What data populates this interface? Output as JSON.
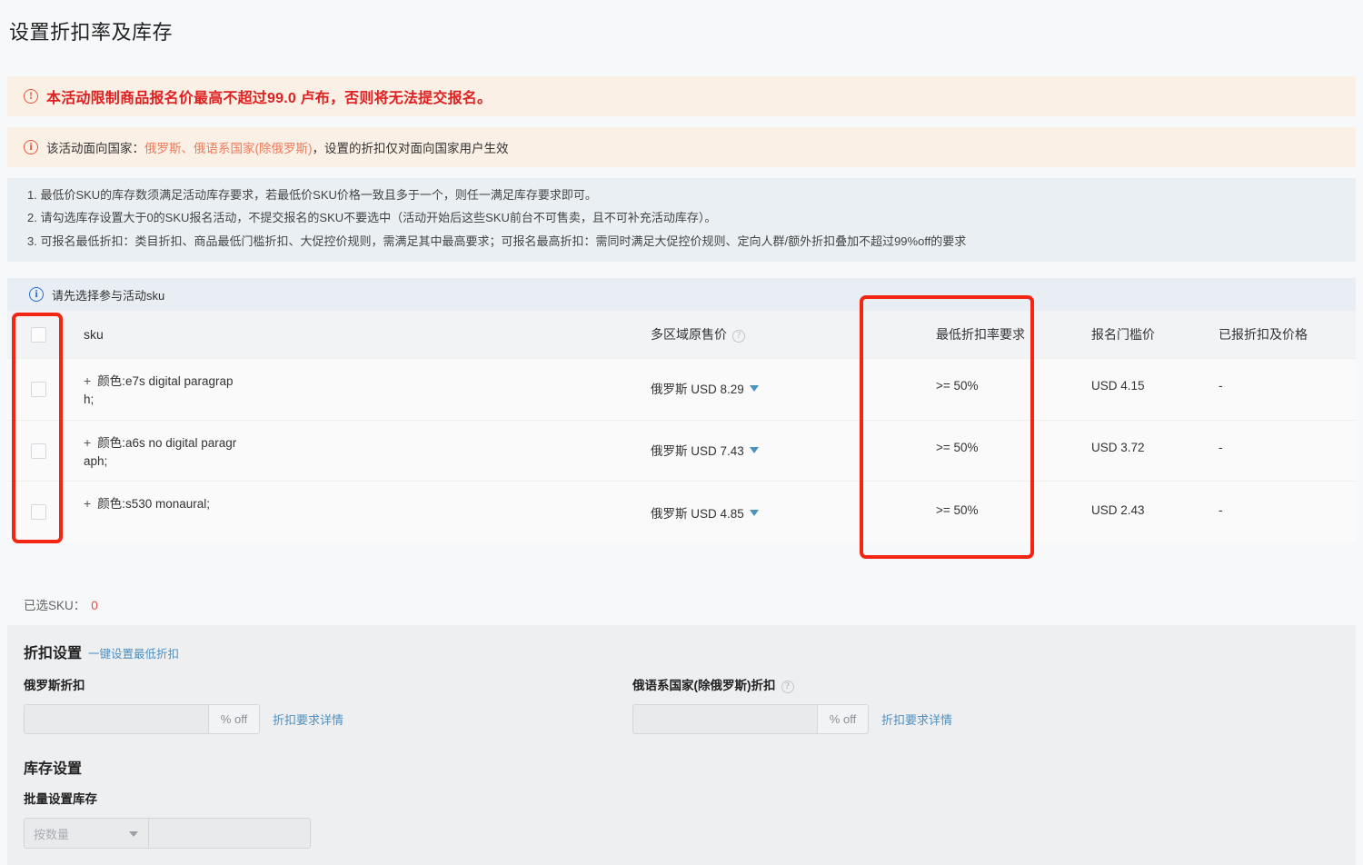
{
  "page_title": "设置折扣率及库存",
  "alerts": {
    "warning": {
      "icon": "exclamation-circle-icon",
      "text": "本活动限制商品报名价最高不超过99.0 卢布，否则将无法提交报名。"
    },
    "info": {
      "icon": "info-circle-icon",
      "prefix": "该活动面向国家：",
      "countries": "俄罗斯、俄语系国家(除俄罗斯)",
      "suffix": "，设置的折扣仅对面向国家用户生效"
    }
  },
  "rules": [
    "1. 最低价SKU的库存数须满足活动库存要求，若最低价SKU价格一致且多于一个，则任一满足库存要求即可。",
    "2. 请勾选库存设置大于0的SKU报名活动，不提交报名的SKU不要选中（活动开始后这些SKU前台不可售卖，且不可补充活动库存）。",
    "3. 可报名最低折扣：类目折扣、商品最低门槛折扣、大促控价规则，需满足其中最高要求；可报名最高折扣：需同时满足大促控价规则、定向人群/额外折扣叠加不超过99%off的要求"
  ],
  "notice": {
    "icon": "info-circle-icon",
    "text": "请先选择参与活动sku"
  },
  "table": {
    "columns": {
      "sku": "sku",
      "original_price": "多区域原售价",
      "min_discount": "最低折扣率要求",
      "threshold_price": "报名门槛价",
      "applied": "已报折扣及价格"
    },
    "rows": [
      {
        "sku": "颜色:e7s digital paragraph;",
        "sku_line1": "颜色:e7s digital paragrap",
        "sku_line2": "h;",
        "region": "俄罗斯",
        "original_price": "USD 8.29",
        "min_discount": ">= 50%",
        "threshold_price": "USD 4.15",
        "applied": "-",
        "checked": false
      },
      {
        "sku": "颜色:a6s no digital paragraph;",
        "sku_line1": "颜色:a6s no digital paragr",
        "sku_line2": "aph;",
        "region": "俄罗斯",
        "original_price": "USD 7.43",
        "min_discount": ">= 50%",
        "threshold_price": "USD 3.72",
        "applied": "-",
        "checked": false
      },
      {
        "sku": "颜色:s530 monaural;",
        "sku_line1": "颜色:s530 monaural;",
        "sku_line2": "",
        "region": "俄罗斯",
        "original_price": "USD 4.85",
        "min_discount": ">= 50%",
        "threshold_price": "USD 2.43",
        "applied": "-",
        "checked": false
      }
    ]
  },
  "selected": {
    "label": "已选SKU：",
    "count": "0"
  },
  "discount_section": {
    "title": "折扣设置",
    "quick_link": "一键设置最低折扣",
    "russia": {
      "label": "俄罗斯折扣",
      "value": "",
      "placeholder": "",
      "suffix": "% off",
      "detail_link": "折扣要求详情"
    },
    "russian_speaking": {
      "label": "俄语系国家(除俄罗斯)折扣",
      "help_icon": "question-circle-icon",
      "value": "",
      "placeholder": "",
      "suffix": "% off",
      "detail_link": "折扣要求详情"
    }
  },
  "inventory_section": {
    "title": "库存设置",
    "label": "批量设置库存",
    "select_value": "按数量",
    "input_value": "",
    "input_placeholder": ""
  },
  "colors": {
    "warning_text": "#e02020",
    "alert_bg": "#fbf0e6",
    "rules_bg": "#eaeff3",
    "notice_bg": "#e8eef4",
    "annotation_red": "#f22613",
    "link_blue": "#4f8fc0",
    "caret_blue": "#4a93bf",
    "count_red": "#e94b4b"
  }
}
